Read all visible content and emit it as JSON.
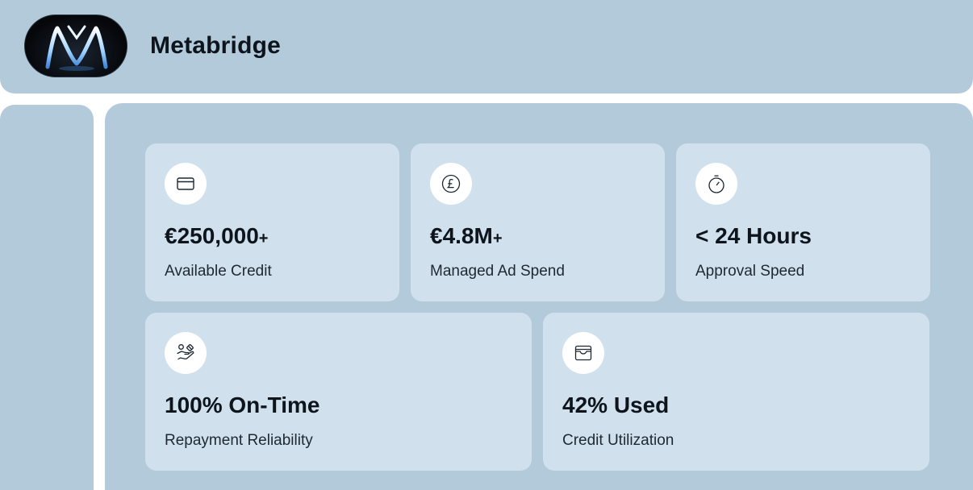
{
  "header": {
    "brand": "Metabridge",
    "logo_icon": "metabridge-m-logo"
  },
  "stats": [
    {
      "icon": "credit-card-icon",
      "value": "€250,000",
      "suffix": "+",
      "label": "Available Credit"
    },
    {
      "icon": "pound-coin-icon",
      "value": "€4.8M",
      "suffix": "+",
      "label": "Managed Ad Spend"
    },
    {
      "icon": "stopwatch-icon",
      "value": "< 24 Hours",
      "suffix": "",
      "label": "Approval Speed"
    },
    {
      "icon": "hand-payment-icon",
      "value": "100% On-Time",
      "suffix": "",
      "label": "Repayment Reliability"
    },
    {
      "icon": "wallet-icon",
      "value": "42% Used",
      "suffix": "",
      "label": "Credit Utilization"
    }
  ],
  "colors": {
    "panel": "#b3cadb",
    "card": "#d0e1ed",
    "text": "#0d141c"
  }
}
